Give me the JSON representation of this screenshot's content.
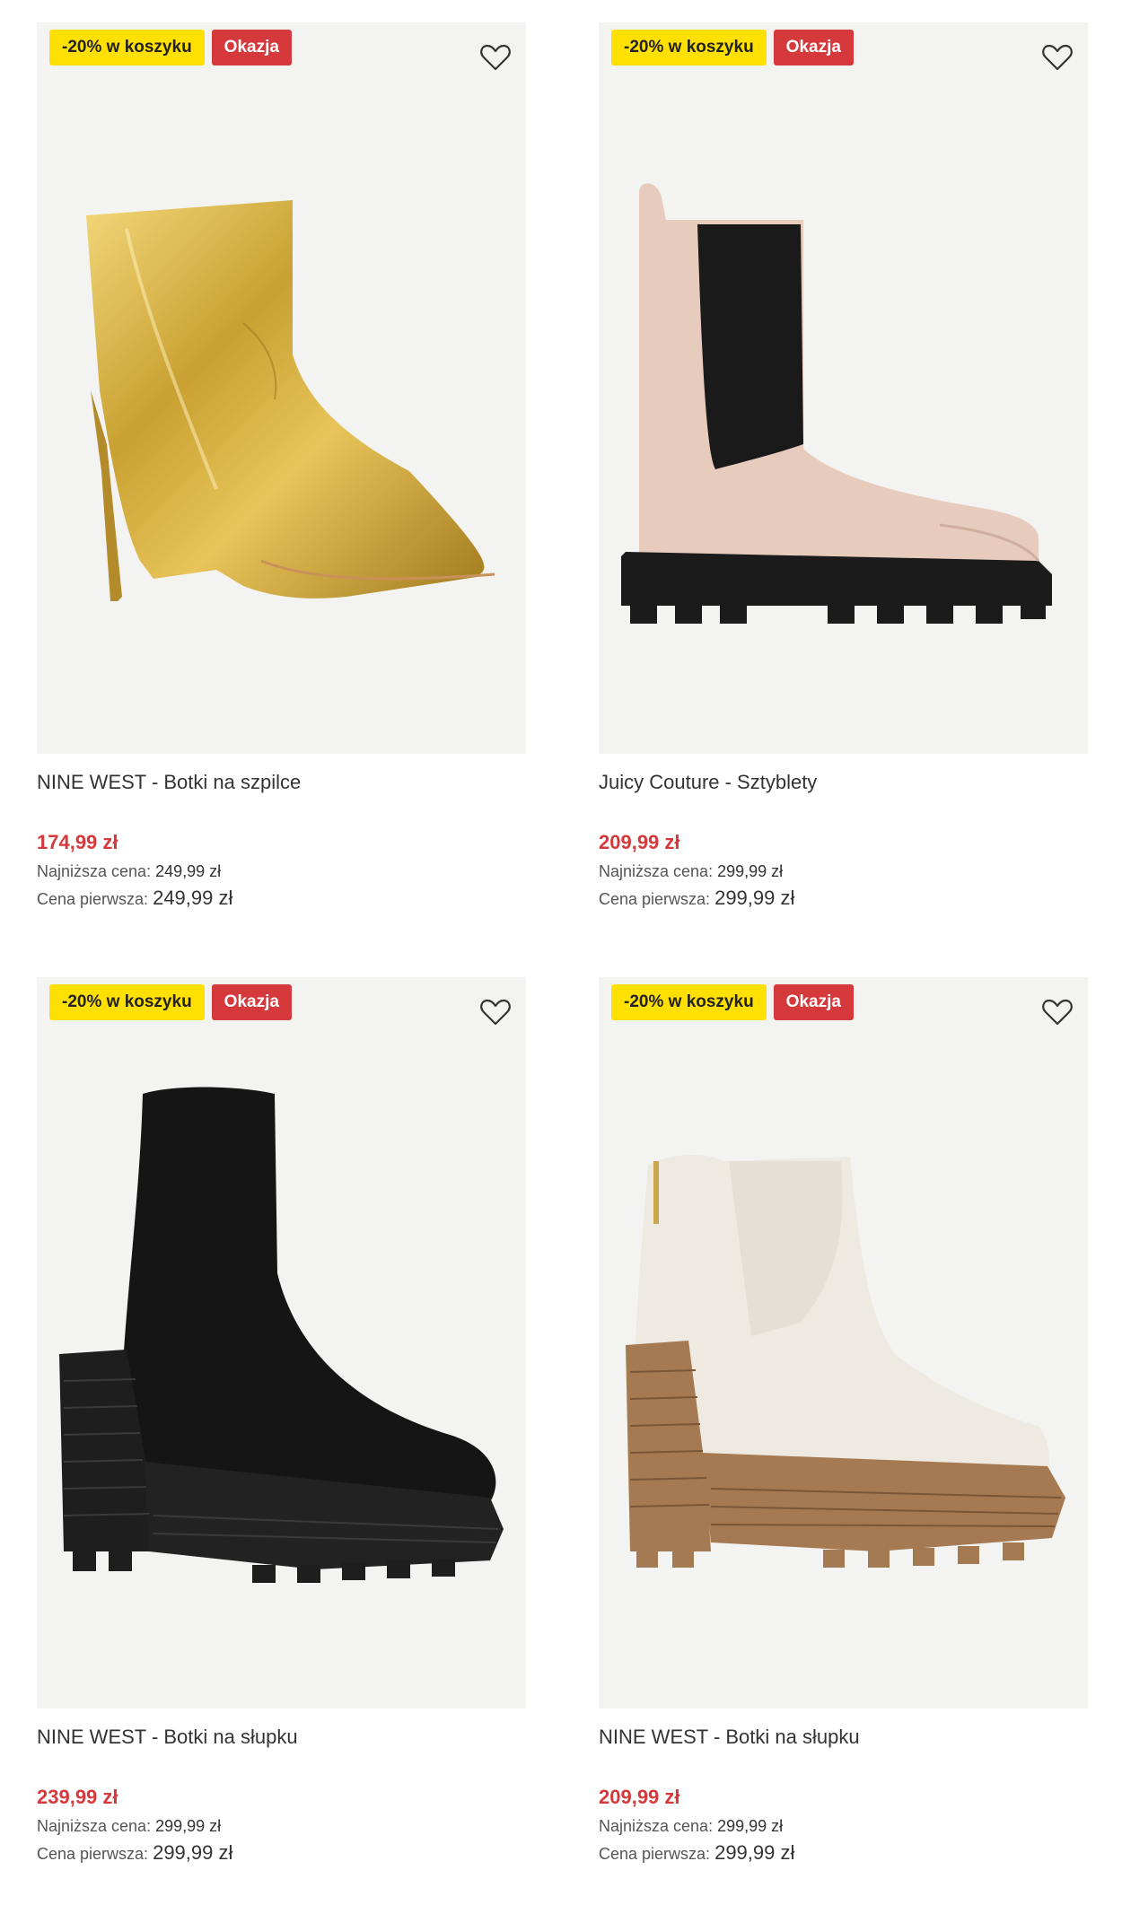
{
  "products": [
    {
      "badge_discount": "-20% w koszyku",
      "badge_deal": "Okazja",
      "title": "NINE WEST - Botki na szpilce",
      "price": "174,99 zł",
      "lowest_label": "Najniższa cena:",
      "lowest_value": "249,99 zł",
      "first_label": "Cena pierwsza:",
      "first_value": "249,99 zł",
      "image": "gold-stiletto-ankle-boot"
    },
    {
      "badge_discount": "-20% w koszyku",
      "badge_deal": "Okazja",
      "title": "Juicy Couture - Sztyblety",
      "price": "209,99 zł",
      "lowest_label": "Najniższa cena:",
      "lowest_value": "299,99 zł",
      "first_label": "Cena pierwsza:",
      "first_value": "299,99 zł",
      "image": "beige-chelsea-platform-boot"
    },
    {
      "badge_discount": "-20% w koszyku",
      "badge_deal": "Okazja",
      "title": "NINE WEST - Botki na słupku",
      "price": "239,99 zł",
      "lowest_label": "Najniższa cena:",
      "lowest_value": "299,99 zł",
      "first_label": "Cena pierwsza:",
      "first_value": "299,99 zł",
      "image": "black-block-heel-sock-boot"
    },
    {
      "badge_discount": "-20% w koszyku",
      "badge_deal": "Okazja",
      "title": "NINE WEST - Botki na słupku",
      "price": "209,99 zł",
      "lowest_label": "Najniższa cena:",
      "lowest_value": "299,99 zł",
      "first_label": "Cena pierwsza:",
      "first_value": "299,99 zł",
      "image": "white-block-heel-chelsea-boot"
    }
  ],
  "colors": {
    "badge_yellow": "#ffe000",
    "badge_red": "#d6393b",
    "price_red": "#d6393b",
    "image_bg": "#f3f3f2"
  },
  "icons": {
    "wishlist": "heart-outline-icon"
  }
}
